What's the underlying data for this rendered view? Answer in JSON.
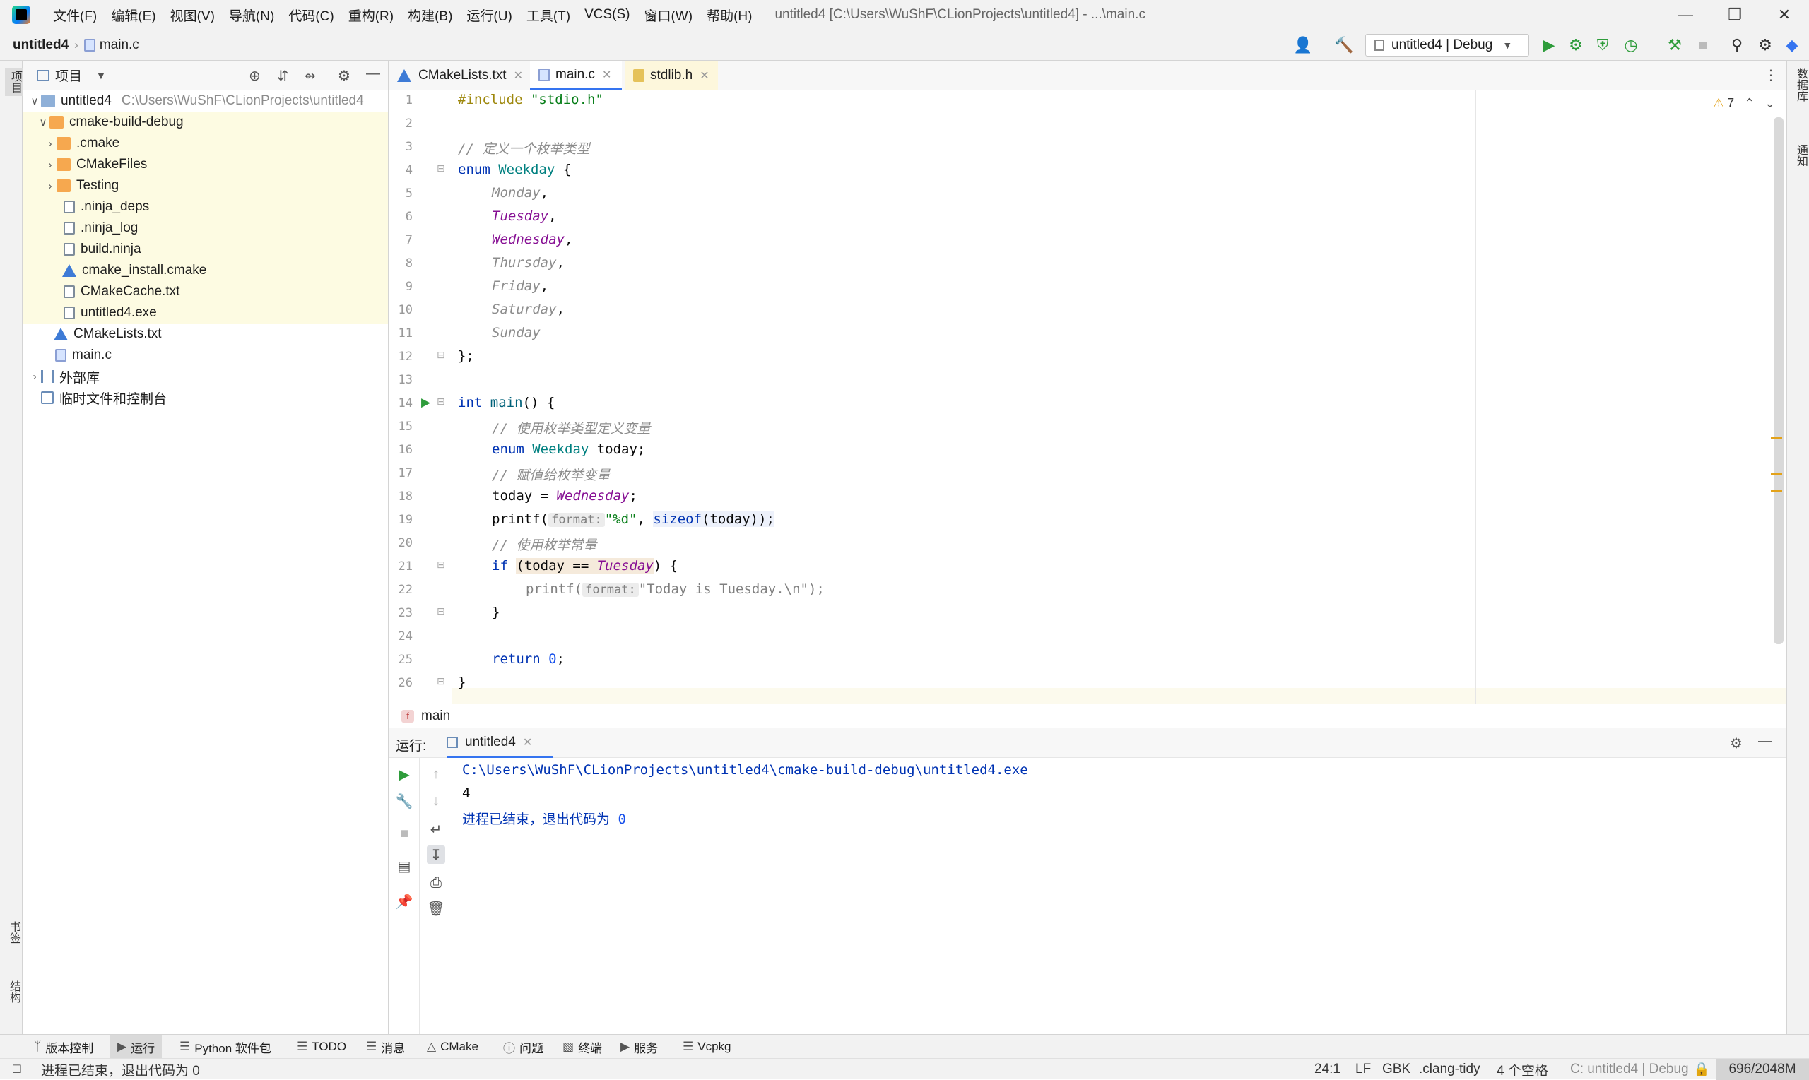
{
  "window": {
    "title": "untitled4 [C:\\Users\\WuShF\\CLionProjects\\untitled4] - ...\\main.c"
  },
  "menu": [
    "文件(F)",
    "编辑(E)",
    "视图(V)",
    "导航(N)",
    "代码(C)",
    "重构(R)",
    "构建(B)",
    "运行(U)",
    "工具(T)",
    "VCS(S)",
    "窗口(W)",
    "帮助(H)"
  ],
  "breadcrumb": {
    "project": "untitled4",
    "file": "main.c"
  },
  "toolbar": {
    "run_config": "untitled4 | Debug"
  },
  "left_strip": {
    "project": "项目",
    "bookmarks": "书签",
    "structure": "结构"
  },
  "right_strip": {
    "database": "数据库",
    "notifications": "通知"
  },
  "project_panel": {
    "title": "项目",
    "tree": [
      {
        "label": "untitled4",
        "path": "C:\\Users\\WuShF\\CLionProjects\\untitled4"
      },
      {
        "label": "cmake-build-debug"
      },
      {
        "label": ".cmake"
      },
      {
        "label": "CMakeFiles"
      },
      {
        "label": "Testing"
      },
      {
        "label": ".ninja_deps"
      },
      {
        "label": ".ninja_log"
      },
      {
        "label": "build.ninja"
      },
      {
        "label": "cmake_install.cmake"
      },
      {
        "label": "CMakeCache.txt"
      },
      {
        "label": "untitled4.exe"
      },
      {
        "label": "CMakeLists.txt"
      },
      {
        "label": "main.c"
      },
      {
        "label": "外部库"
      },
      {
        "label": "临时文件和控制台"
      }
    ]
  },
  "tabs": [
    "CMakeLists.txt",
    "main.c",
    "stdlib.h"
  ],
  "editor": {
    "warnings": "7",
    "line_numbers": [
      "1",
      "2",
      "3",
      "4",
      "5",
      "6",
      "7",
      "8",
      "9",
      "10",
      "11",
      "12",
      "13",
      "14",
      "15",
      "16",
      "17",
      "18",
      "19",
      "20",
      "21",
      "22",
      "23",
      "24",
      "25",
      "26"
    ],
    "code": {
      "l1a": "#include ",
      "l1b": "\"stdio.h\"",
      "l3": "// 定义一个枚举类型",
      "l4a": "enum ",
      "l4b": "Weekday",
      " l4c": " {",
      "l5": "Monday",
      "l6": "Tuesday",
      "l7": "Wednesday",
      "l8": "Thursday",
      "l9": "Friday",
      "l10": "Saturday",
      "l11": "Sunday",
      "l12": "};",
      "l14a": "int ",
      "l14b": "main",
      "l14c": "() {",
      "l15": "// 使用枚举类型定义变量",
      "l16a": "enum ",
      "l16b": "Weekday",
      "l16c": " today;",
      "l17": "// 赋值给枚举变量",
      "l18a": "today = ",
      "l18b": "Wednesday",
      "l18c": ";",
      "l19a": "printf(",
      "l19hint": "format:",
      "l19b": "\"%d\"",
      ", l19c": ", ",
      "l19d": "sizeof",
      "l19e": "(today));",
      "l20": "// 使用枚举常量",
      "l21a": "if ",
      "l21b": "(today == ",
      "l21c": "Tuesday",
      "l21d": ") {",
      "l22a": "printf(",
      "l22hint": "format:",
      "l22b": "\"Today is Tuesday.\\n\");",
      "l23": "}",
      "l25a": "return ",
      "l25b": "0",
      ";": ";",
      "l26": "}",
      "comma": ","
    }
  },
  "code_breadcrumb": "main",
  "run": {
    "label": "运行:",
    "tab": "untitled4",
    "output": [
      "C:\\Users\\WuShF\\CLionProjects\\untitled4\\cmake-build-debug\\untitled4.exe",
      "4",
      "进程已结束，退出代码为 ",
      "0"
    ]
  },
  "bottom_tools": [
    "版本控制",
    "运行",
    "Python 软件包",
    "TODO",
    "消息",
    "CMake",
    "问题",
    "终端",
    "服务",
    "Vcpkg"
  ],
  "status": {
    "message": "进程已结束，退出代码为 0",
    "position": "24:1",
    "line_sep": "LF",
    "encoding": "GBK",
    "inspector": ".clang-tidy",
    "indent": "4 个空格",
    "context": "C: untitled4 | Debug",
    "memory": "696/2048M"
  }
}
